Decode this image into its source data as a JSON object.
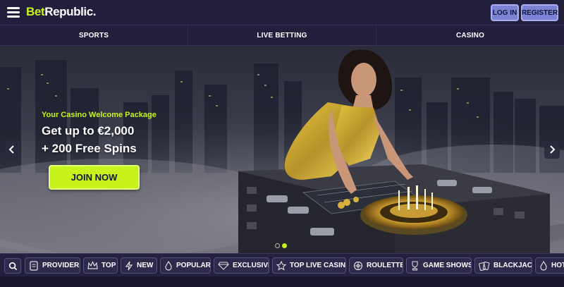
{
  "header": {
    "logo_part1": "Bet",
    "logo_part2": "Republic",
    "logo_dot": ".",
    "login_label": "LOG IN",
    "register_label": "REGISTER",
    "accent_color": "#c5f31b"
  },
  "nav": {
    "items": [
      "SPORTS",
      "LIVE BETTING",
      "CASINO"
    ]
  },
  "hero": {
    "subtitle": "Your Casino Welcome Package",
    "headline_line1": "Get up to €2,000",
    "headline_line2": "+ 200 Free Spins",
    "cta_label": "JOIN NOW",
    "slide_count": 2,
    "active_slide": 2
  },
  "categories": {
    "search_icon": "search-icon",
    "items": [
      {
        "label": "PROVIDERS",
        "icon": "providers-icon"
      },
      {
        "label": "TOP",
        "icon": "crown-icon"
      },
      {
        "label": "NEW",
        "icon": "lightning-icon"
      },
      {
        "label": "POPULAR",
        "icon": "flame-icon"
      },
      {
        "label": "EXCLUSIVE",
        "icon": "diamond-icon"
      },
      {
        "label": "TOP LIVE CASINO",
        "icon": "star-icon"
      },
      {
        "label": "ROULETTE",
        "icon": "roulette-icon"
      },
      {
        "label": "GAME SHOWS",
        "icon": "trophy-icon"
      },
      {
        "label": "BLACKJACK",
        "icon": "cards-icon"
      },
      {
        "label": "HOT",
        "icon": "hot-icon"
      }
    ]
  }
}
